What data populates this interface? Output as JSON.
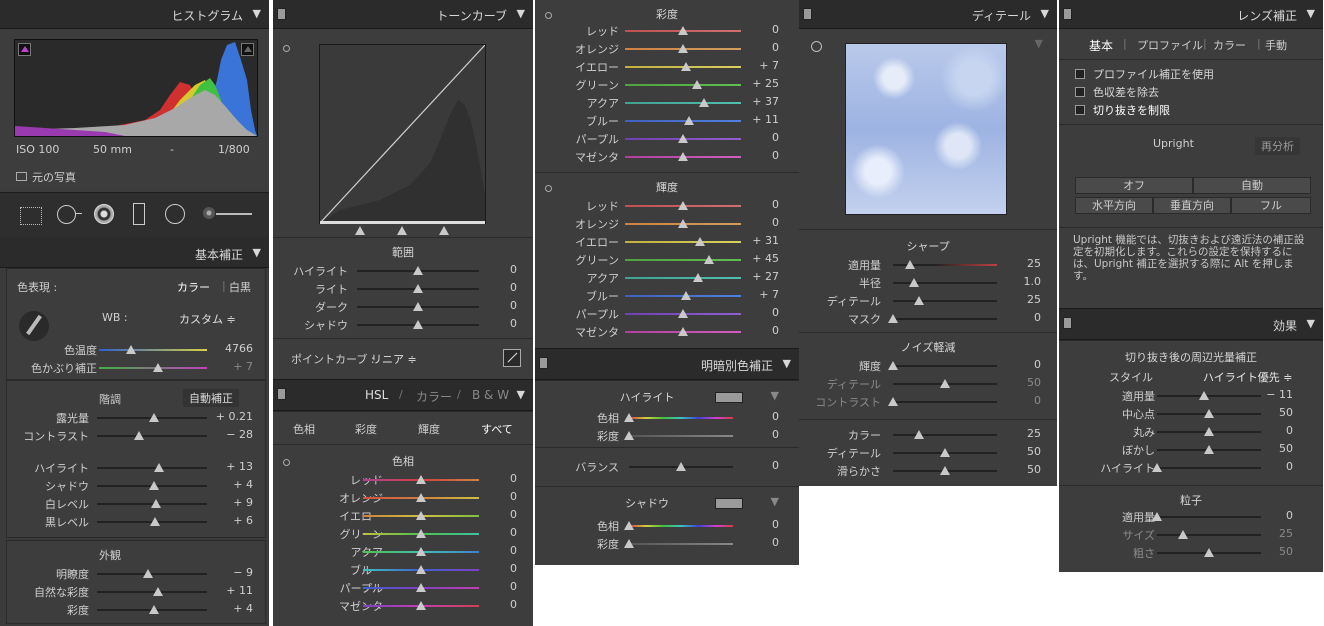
{
  "colors": {
    "panel": "#3b3b3b",
    "header": "#2b2b2b",
    "text": "#cfcfcf",
    "track": "#222222"
  },
  "histogram": {
    "title": "ヒストグラム",
    "iso": "ISO 100",
    "focal": "50 mm",
    "dash": "-",
    "shutter": "1/800",
    "original_photo": "元の写真"
  },
  "basic": {
    "title": "基本補正",
    "treatment_label": "色表現 :",
    "color": "カラー",
    "bw": "白黒",
    "wb_label": "WB :",
    "wb_value": "カスタム ≑",
    "temp": {
      "label": "色温度",
      "value": "4766",
      "pos": 0.3
    },
    "tint": {
      "label": "色かぶり補正",
      "value": "+ 7",
      "pos": 0.55
    },
    "tone_label": "階調",
    "auto": "自動補正",
    "exposure": {
      "label": "露光量",
      "value": "+ 0.21",
      "pos": 0.52
    },
    "contrast": {
      "label": "コントラスト",
      "value": "− 28",
      "pos": 0.38
    },
    "highlights": {
      "label": "ハイライト",
      "value": "+ 13",
      "pos": 0.56
    },
    "shadows": {
      "label": "シャドウ",
      "value": "+ 4",
      "pos": 0.52
    },
    "whites": {
      "label": "白レベル",
      "value": "+ 9",
      "pos": 0.54
    },
    "blacks": {
      "label": "黒レベル",
      "value": "+ 6",
      "pos": 0.53
    },
    "presence_label": "外観",
    "clarity": {
      "label": "明瞭度",
      "value": "− 9",
      "pos": 0.46
    },
    "vibrance": {
      "label": "自然な彩度",
      "value": "+ 11",
      "pos": 0.55
    },
    "saturation": {
      "label": "彩度",
      "value": "+ 4",
      "pos": 0.52
    }
  },
  "tonecurve": {
    "title": "トーンカーブ",
    "range_label": "範囲",
    "highlights": {
      "label": "ハイライト",
      "value": "0",
      "pos": 0.5
    },
    "lights": {
      "label": "ライト",
      "value": "0",
      "pos": 0.5
    },
    "darks": {
      "label": "ダーク",
      "value": "0",
      "pos": 0.5
    },
    "shadows": {
      "label": "シャドウ",
      "value": "0",
      "pos": 0.5
    },
    "point_curve_label": "ポイントカーブ :",
    "point_curve_value": "リニア ≑"
  },
  "hsl": {
    "title_hsl": "HSL",
    "sep": "/",
    "title_color": "カラー",
    "title_bw": "B & W",
    "tabs": [
      "色相",
      "彩度",
      "輝度",
      "すべて"
    ],
    "hue_label": "色相",
    "items": [
      {
        "label": "レッド",
        "value": "0",
        "pos": 0.5
      },
      {
        "label": "オレンジ",
        "value": "0",
        "pos": 0.5
      },
      {
        "label": "イエロー",
        "value": "0",
        "pos": 0.5
      },
      {
        "label": "グリーン",
        "value": "0",
        "pos": 0.5
      },
      {
        "label": "アクア",
        "value": "0",
        "pos": 0.5
      },
      {
        "label": "ブルー",
        "value": "0",
        "pos": 0.5
      },
      {
        "label": "パープル",
        "value": "0",
        "pos": 0.5
      },
      {
        "label": "マゼンタ",
        "value": "0",
        "pos": 0.5
      }
    ]
  },
  "saturation": {
    "title": "彩度",
    "items": [
      {
        "label": "レッド",
        "value": "0",
        "pos": 0.5
      },
      {
        "label": "オレンジ",
        "value": "0",
        "pos": 0.5
      },
      {
        "label": "イエロー",
        "value": "+ 7",
        "pos": 0.53
      },
      {
        "label": "グリーン",
        "value": "+ 25",
        "pos": 0.62
      },
      {
        "label": "アクア",
        "value": "+ 37",
        "pos": 0.68
      },
      {
        "label": "ブルー",
        "value": "+ 11",
        "pos": 0.55
      },
      {
        "label": "パープル",
        "value": "0",
        "pos": 0.5
      },
      {
        "label": "マゼンタ",
        "value": "0",
        "pos": 0.5
      }
    ]
  },
  "luminance": {
    "title": "輝度",
    "items": [
      {
        "label": "レッド",
        "value": "0",
        "pos": 0.5
      },
      {
        "label": "オレンジ",
        "value": "0",
        "pos": 0.5
      },
      {
        "label": "イエロー",
        "value": "+ 31",
        "pos": 0.65
      },
      {
        "label": "グリーン",
        "value": "+ 45",
        "pos": 0.72
      },
      {
        "label": "アクア",
        "value": "+ 27",
        "pos": 0.63
      },
      {
        "label": "ブルー",
        "value": "+ 7",
        "pos": 0.53
      },
      {
        "label": "パープル",
        "value": "0",
        "pos": 0.5
      },
      {
        "label": "マゼンタ",
        "value": "0",
        "pos": 0.5
      }
    ]
  },
  "split": {
    "title": "明暗別色補正",
    "highlight_label": "ハイライト",
    "hl_hue": {
      "label": "色相",
      "value": "0",
      "pos": 0.0
    },
    "hl_sat": {
      "label": "彩度",
      "value": "0",
      "pos": 0.0
    },
    "balance": {
      "label": "バランス",
      "value": "0",
      "pos": 0.5
    },
    "shadow_label": "シャドウ",
    "sh_hue": {
      "label": "色相",
      "value": "0",
      "pos": 0.0
    },
    "sh_sat": {
      "label": "彩度",
      "value": "0",
      "pos": 0.0
    }
  },
  "detail": {
    "title": "ディテール",
    "sharpen_label": "シャープ",
    "amount": {
      "label": "適用量",
      "value": "25",
      "pos": 0.16
    },
    "radius": {
      "label": "半径",
      "value": "1.0",
      "pos": 0.2
    },
    "detail": {
      "label": "ディテール",
      "value": "25",
      "pos": 0.25
    },
    "masking": {
      "label": "マスク",
      "value": "0",
      "pos": 0.0
    },
    "nr_label": "ノイズ軽減",
    "lum": {
      "label": "輝度",
      "value": "0",
      "pos": 0.0
    },
    "lum_detail": {
      "label": "ディテール",
      "value": "50",
      "pos": 0.5
    },
    "lum_contrast": {
      "label": "コントラスト",
      "value": "0",
      "pos": 0.0
    },
    "color": {
      "label": "カラー",
      "value": "25",
      "pos": 0.25
    },
    "color_detail": {
      "label": "ディテール",
      "value": "50",
      "pos": 0.5
    },
    "smoothness": {
      "label": "滑らかさ",
      "value": "50",
      "pos": 0.5
    }
  },
  "lens": {
    "title": "レンズ補正",
    "tabs": [
      "基本",
      "プロファイル",
      "カラー",
      "手動"
    ],
    "checks": [
      "プロファイル補正を使用",
      "色収差を除去",
      "切り抜きを制限"
    ],
    "upright": "Upright",
    "reanalyze": "再分析",
    "off": "オフ",
    "auto": "自動",
    "level": "水平方向",
    "vertical": "垂直方向",
    "full": "フル",
    "info": "Upright 機能では、切抜きおよび遠近法の補正設定を初期化します。これらの設定を保持するには、Upright 補正を選択する際に Alt を押します。"
  },
  "effects": {
    "title": "効果",
    "vignette_label": "切り抜き後の周辺光量補正",
    "style_label": "スタイル",
    "style_value": "ハイライト優先 ≑",
    "amount": {
      "label": "適用量",
      "value": "− 11",
      "pos": 0.45
    },
    "midpoint": {
      "label": "中心点",
      "value": "50",
      "pos": 0.5
    },
    "roundness": {
      "label": "丸み",
      "value": "0",
      "pos": 0.5
    },
    "feather": {
      "label": "ぼかし",
      "value": "50",
      "pos": 0.5
    },
    "highlights": {
      "label": "ハイライト",
      "value": "0",
      "pos": 0.0
    },
    "grain_label": "粒子",
    "g_amount": {
      "label": "適用量",
      "value": "0",
      "pos": 0.0
    },
    "g_size": {
      "label": "サイズ",
      "value": "25",
      "pos": 0.25
    },
    "g_rough": {
      "label": "粗さ",
      "value": "50",
      "pos": 0.5
    }
  }
}
